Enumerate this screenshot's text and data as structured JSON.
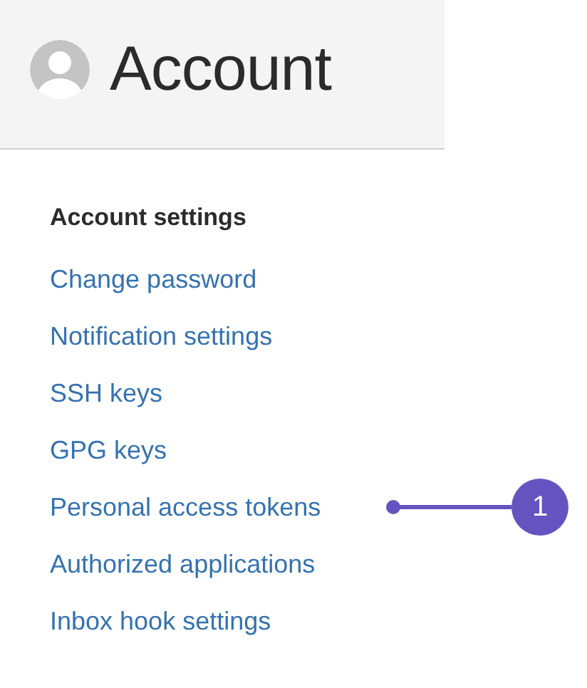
{
  "header": {
    "title": "Account"
  },
  "menu": {
    "heading": "Account settings",
    "items": [
      {
        "label": "Change password"
      },
      {
        "label": "Notification settings"
      },
      {
        "label": "SSH keys"
      },
      {
        "label": "GPG keys"
      },
      {
        "label": "Personal access tokens",
        "callout": "1"
      },
      {
        "label": "Authorized applications"
      },
      {
        "label": "Inbox hook settings"
      }
    ]
  }
}
